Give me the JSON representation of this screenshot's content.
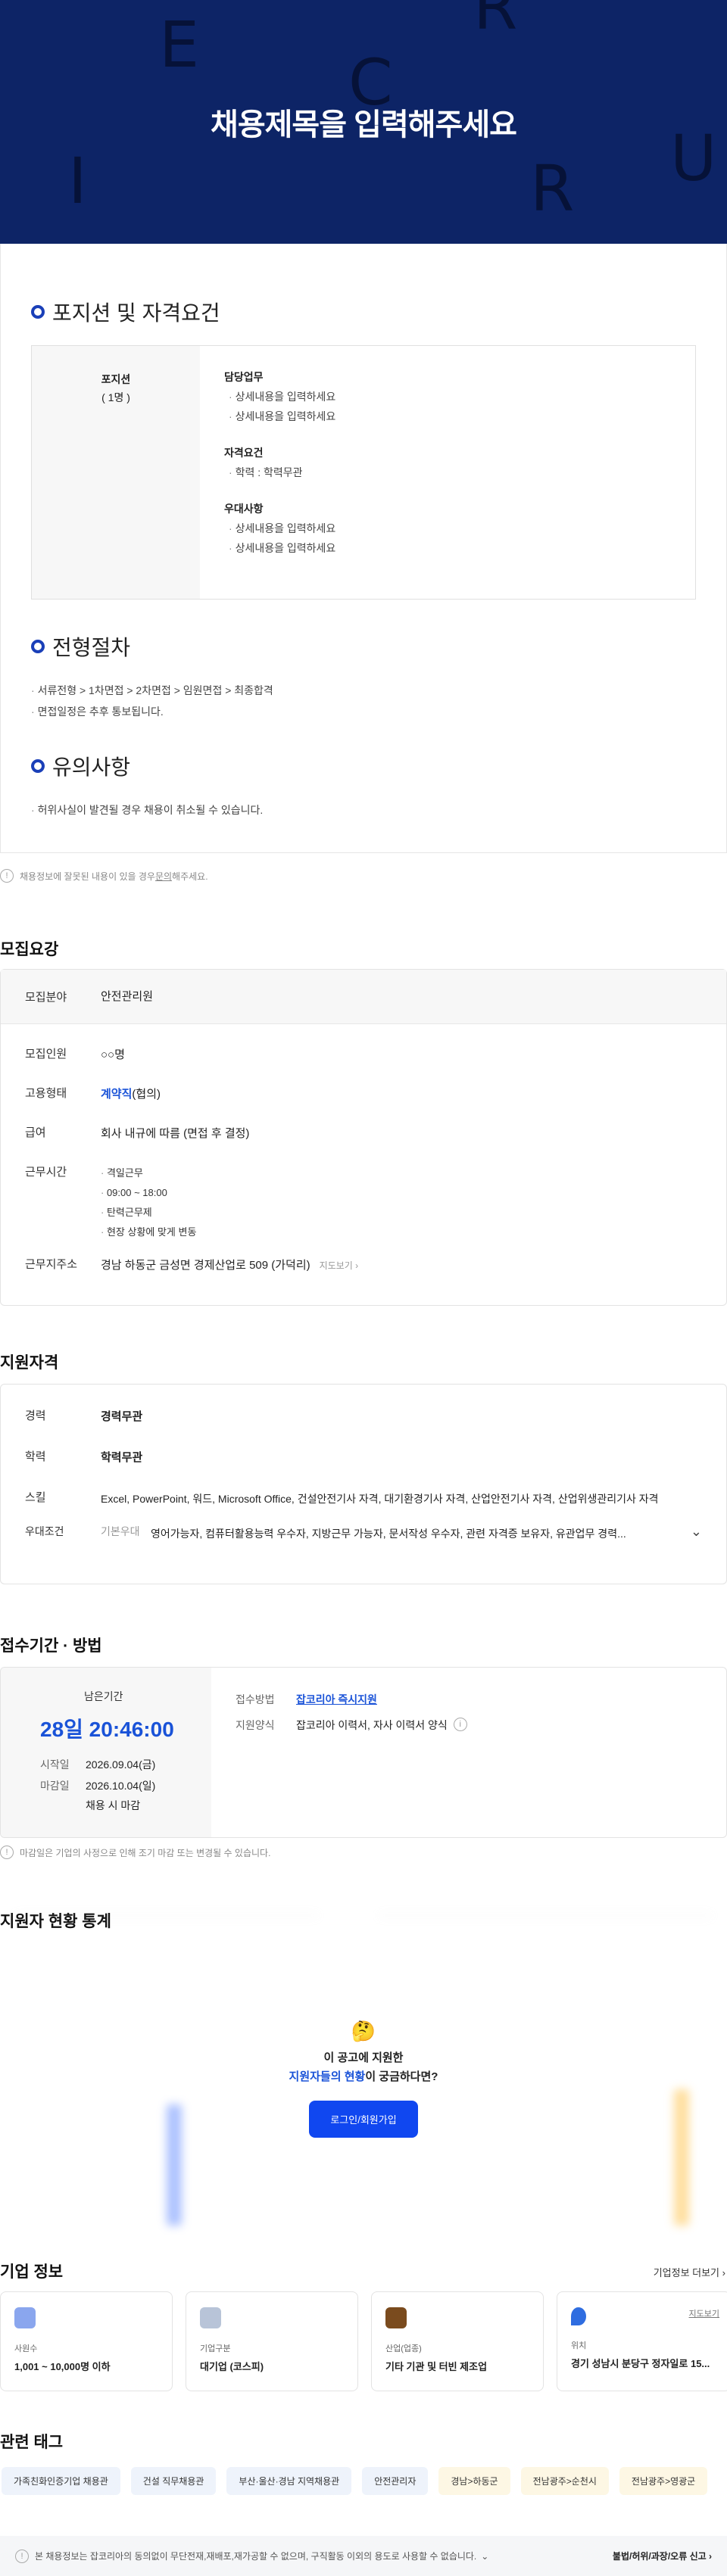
{
  "hero": {
    "title": "채용제목을 입력해주세요",
    "deco": [
      "E",
      "R",
      "C",
      "U",
      "R",
      "I"
    ]
  },
  "position": {
    "section_title": "포지션 및 자격요건",
    "left_title": "포지션",
    "left_count": "( 1명 )",
    "groups": [
      {
        "title": "담당업무",
        "items": [
          "상세내용을 입력하세요",
          "상세내용을 입력하세요"
        ]
      },
      {
        "title": "자격요건",
        "items": [
          "학력 : 학력무관"
        ]
      },
      {
        "title": "우대사항",
        "items": [
          "상세내용을 입력하세요",
          "상세내용을 입력하세요"
        ]
      }
    ]
  },
  "process": {
    "section_title": "전형절차",
    "items": [
      "서류전형 > 1차면접 > 2차면접 > 임원면접 > 최종합격",
      "면접일정은 추후 통보됩니다."
    ]
  },
  "caution": {
    "section_title": "유의사항",
    "items": [
      "허위사실이 발견될 경우 채용이 취소될 수 있습니다."
    ]
  },
  "report_notice": {
    "pre": "채용정보에 잘못된 내용이 있을 경우 ",
    "link": "문의",
    "post": "해주세요."
  },
  "recruit": {
    "title": "모집요강",
    "field_label": "모집분야",
    "field_value": "안전관리원",
    "rows": [
      {
        "k": "모집인원",
        "v": "○○명"
      },
      {
        "k": "고용형태",
        "v_blue": "계약직",
        "v": "(협의)"
      },
      {
        "k": "급여",
        "v": "회사 내규에 따름 (면접 후 결정)"
      }
    ],
    "hours_label": "근무시간",
    "hours": [
      "격일근무",
      "09:00 ~ 18:00",
      "탄력근무제",
      "현장 상황에 맞게 변동"
    ],
    "addr_label": "근무지주소",
    "addr": "경남 하동군 금성면 경제산업로 509 (가덕리)",
    "map": "지도보기"
  },
  "qual": {
    "title": "지원자격",
    "career_label": "경력",
    "career": "경력무관",
    "edu_label": "학력",
    "edu": "학력무관",
    "skill_label": "스킬",
    "skill": "Excel, PowerPoint, 워드, Microsoft Office, 건설안전기사 자격, 대기환경기사 자격, 산업안전기사 자격, 산업위생관리기사 자격",
    "pref_label": "우대조건",
    "pref_sub": "기본우대",
    "pref": "영어가능자, 컴퓨터활용능력 우수자, 지방근무 가능자, 문서작성 우수자, 관련 자격증 보유자, 유관업무 경력..."
  },
  "apply": {
    "title": "접수기간 · 방법",
    "remain_label": "남은기간",
    "remain": "28일 20:46:00",
    "start_label": "시작일",
    "start": "2026.09.04(금)",
    "end_label": "마감일",
    "end": "2026.10.04(일)",
    "close_note": "채용 시 마감",
    "method_label": "접수방법",
    "method": "잡코리아 즉시지원",
    "form_label": "지원양식",
    "form": "잡코리아 이력서, 자사 이력서 양식",
    "notice": "마감일은 기업의 사정으로 인해 조기 마감 또는 변경될 수 있습니다."
  },
  "stats": {
    "title": "지원자 현황 통계",
    "line1": "이 공고에 지원한",
    "line2_blue": "지원자들의 현황",
    "line2_post": "이 궁금하다면?",
    "btn": "로그인/회원가입"
  },
  "company": {
    "title": "기업 정보",
    "more": "기업정보 더보기",
    "cards": [
      {
        "label": "사원수",
        "value": "1,001 ~ 10,000명 이하",
        "color": "#8aa6ee"
      },
      {
        "label": "기업구분",
        "value": "대기업 (코스피)",
        "color": "#b8c4d8"
      },
      {
        "label": "산업(업종)",
        "value": "기타 기관 및 터빈 제조업",
        "color": "#7a4b1e"
      },
      {
        "label": "위치",
        "value": "경기 성남시 분당구 정자일로 15...",
        "color": "#2f6de0",
        "link": "지도보기"
      }
    ]
  },
  "tags": {
    "title": "관련 태그",
    "items": [
      "가족친화인증기업 채용관",
      "건설 직무채용관",
      "부산·울산·경남 지역채용관",
      "안전관리자",
      "경남>하동군",
      "전남광주>순천시",
      "전남광주>영광군"
    ]
  },
  "footer": {
    "notice": "본 채용정보는 잡코리아의 동의없이 무단전재,재배포,재가공할 수 없으며, 구직활동 이외의 용도로 사용할 수 없습니다.",
    "report": "불법/허위/과장/오류 신고"
  }
}
